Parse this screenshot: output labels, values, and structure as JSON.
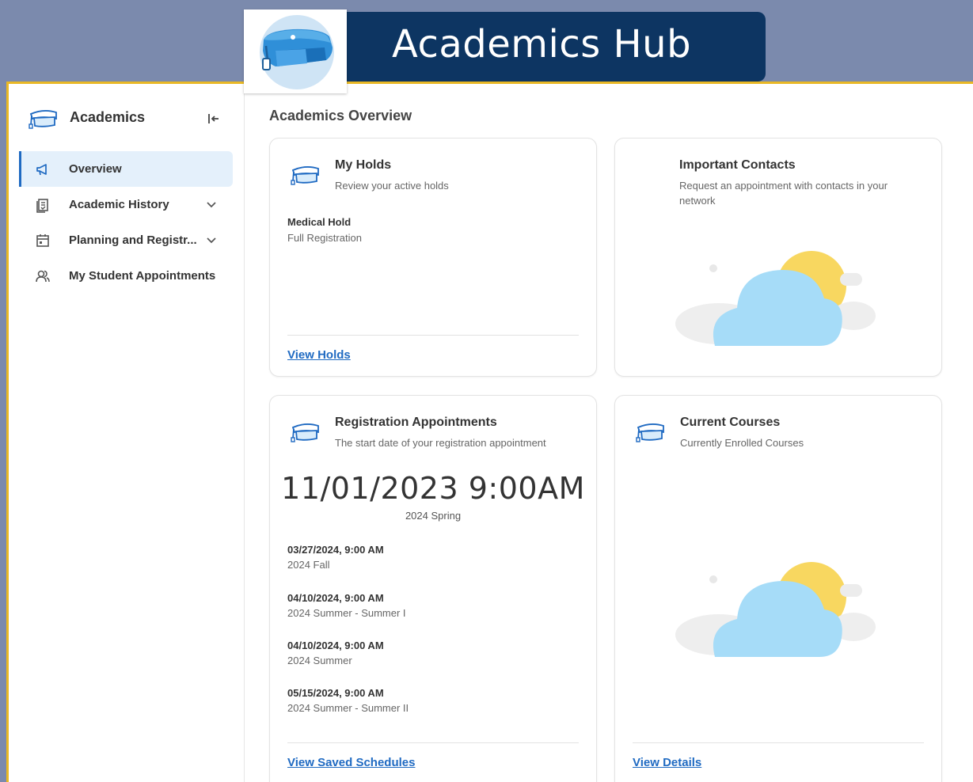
{
  "banner": {
    "title": "Academics Hub",
    "logo_icon": "graduation-cap-icon"
  },
  "sidebar": {
    "title": "Academics",
    "collapse_icon": "collapse-left-icon",
    "items": [
      {
        "label": "Overview",
        "icon": "megaphone-icon",
        "active": true
      },
      {
        "label": "Academic History",
        "icon": "document-icon",
        "expandable": true
      },
      {
        "label": "Planning and Registr...",
        "icon": "calendar-icon",
        "expandable": true
      },
      {
        "label": "My Student Appointments",
        "icon": "users-icon"
      }
    ]
  },
  "main": {
    "title": "Academics Overview",
    "holds": {
      "title": "My Holds",
      "subtitle": "Review your active holds",
      "hold_name": "Medical Hold",
      "hold_type": "Full Registration",
      "link": "View Holds"
    },
    "contacts": {
      "title": "Important Contacts",
      "subtitle": "Request an appointment with contacts in your network"
    },
    "registration": {
      "title": "Registration Appointments",
      "subtitle": "The start date of your registration appointment",
      "main_date": "11/01/2023 9:00AM",
      "main_term": "2024 Spring",
      "appointments": [
        {
          "date": "03/27/2024, 9:00 AM",
          "term": "2024 Fall"
        },
        {
          "date": "04/10/2024, 9:00 AM",
          "term": "2024 Summer - Summer I"
        },
        {
          "date": "04/10/2024, 9:00 AM",
          "term": "2024 Summer"
        },
        {
          "date": "05/15/2024, 9:00 AM",
          "term": "2024 Summer - Summer II"
        }
      ],
      "link": "View Saved Schedules"
    },
    "courses": {
      "title": "Current Courses",
      "subtitle": "Currently Enrolled Courses",
      "link": "View Details"
    }
  },
  "colors": {
    "navy": "#0d3562",
    "accent_blue": "#1f6ac2",
    "gold": "#e9b824",
    "background": "#7b8aad"
  }
}
